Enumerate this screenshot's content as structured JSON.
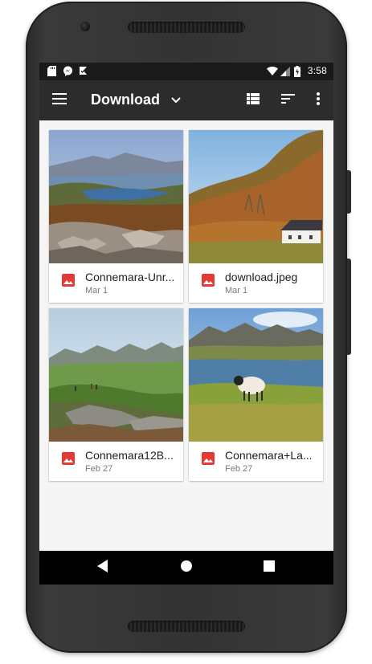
{
  "status_bar": {
    "time": "3:58",
    "left_icons": [
      "sd-card-icon",
      "messenger-icon",
      "download-done-icon"
    ],
    "right_icons": [
      "wifi-icon",
      "cell-signal-icon",
      "battery-charging-icon"
    ]
  },
  "app_bar": {
    "title": "Download",
    "icons": [
      "menu-icon",
      "chevron-down-icon",
      "list-view-icon",
      "sort-icon",
      "more-vert-icon"
    ]
  },
  "files": [
    {
      "name": "Connemara-Unr...",
      "date": "Mar 1",
      "icon": "image-icon"
    },
    {
      "name": "download.jpeg",
      "date": "Mar 1",
      "icon": "image-icon"
    },
    {
      "name": "Connemara12B...",
      "date": "Feb 27",
      "icon": "image-icon"
    },
    {
      "name": "Connemara+La...",
      "date": "Feb 27",
      "icon": "image-icon"
    }
  ],
  "nav_bar": {
    "icons": [
      "back-icon",
      "home-icon",
      "recents-icon"
    ]
  },
  "colors": {
    "app_bar": "#2c2c2c",
    "status_bar": "#1a1a1a",
    "background": "#f5f5f5",
    "image_icon": "#e53935"
  }
}
